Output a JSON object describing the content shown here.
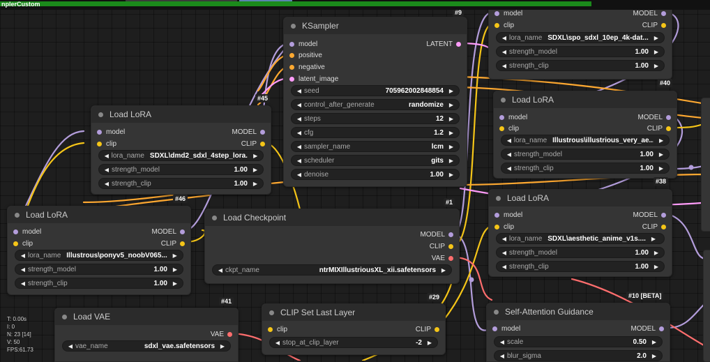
{
  "topbar": {
    "title": "nplerCustom"
  },
  "stats": {
    "t": "T: 0.00s",
    "i": "I: 0",
    "n": "N: 23 [14]",
    "v": "V: 50",
    "fps": "FPS:61.73"
  },
  "badges": {
    "b45": "#45",
    "b40": "#40",
    "b38": "#38",
    "b46": "#46",
    "b1": "#1",
    "b29": "#29",
    "b41": "#41",
    "b10": "#10 [BETA]",
    "b9": "#9"
  },
  "ksampler": {
    "title": "KSampler",
    "inputs": [
      "model",
      "positive",
      "negative",
      "latent_image"
    ],
    "output": "LATENT",
    "widgets": [
      {
        "label": "seed",
        "value": "705962002848854"
      },
      {
        "label": "control_after_generate",
        "value": "randomize"
      },
      {
        "label": "steps",
        "value": "12"
      },
      {
        "label": "cfg",
        "value": "1.2"
      },
      {
        "label": "sampler_name",
        "value": "lcm"
      },
      {
        "label": "scheduler",
        "value": "gits"
      },
      {
        "label": "denoise",
        "value": "1.00"
      }
    ]
  },
  "lora_top_right": {
    "inputs": [
      "model",
      "clip"
    ],
    "outputs": [
      "MODEL",
      "CLIP"
    ],
    "lora_label": "lora_name",
    "lora_value": "SDXL\\spo_sdxl_10ep_4k-dat...",
    "sm_label": "strength_model",
    "sm_value": "1.00",
    "sc_label": "strength_clip",
    "sc_value": "1.00"
  },
  "lora38": {
    "title": "Load LoRA",
    "inputs": [
      "model",
      "clip"
    ],
    "outputs": [
      "MODEL",
      "CLIP"
    ],
    "lora_label": "lora_name",
    "lora_value": "Illustrous\\illustrious_very_ae...",
    "sm_label": "strength_model",
    "sm_value": "1.00",
    "sc_label": "strength_clip",
    "sc_value": "1.00"
  },
  "lora10": {
    "title": "Load LoRA",
    "inputs": [
      "model",
      "clip"
    ],
    "outputs": [
      "MODEL",
      "CLIP"
    ],
    "lora_label": "lora_name",
    "lora_value": "SDXL\\aesthetic_anime_v1s....",
    "sm_label": "strength_model",
    "sm_value": "1.00",
    "sc_label": "strength_clip",
    "sc_value": "1.00"
  },
  "lora46": {
    "title": "Load LoRA",
    "inputs": [
      "model",
      "clip"
    ],
    "outputs": [
      "MODEL",
      "CLIP"
    ],
    "lora_label": "lora_name",
    "lora_value": "SDXL\\dmd2_sdxl_4step_lora...",
    "sm_label": "strength_model",
    "sm_value": "1.00",
    "sc_label": "strength_clip",
    "sc_value": "1.00"
  },
  "lora41": {
    "title": "Load LoRA",
    "inputs": [
      "model",
      "clip"
    ],
    "outputs": [
      "MODEL",
      "CLIP"
    ],
    "lora_label": "lora_name",
    "lora_value": "Illustrous\\ponyv5_noobV065...",
    "sm_label": "strength_model",
    "sm_value": "1.00",
    "sc_label": "strength_clip",
    "sc_value": "1.00"
  },
  "checkpoint": {
    "title": "Load Checkpoint",
    "outputs": [
      "MODEL",
      "CLIP",
      "VAE"
    ],
    "ckpt_label": "ckpt_name",
    "ckpt_value": "ntrMIXIllustriousXL_xii.safetensors"
  },
  "vae": {
    "title": "Load VAE",
    "output": "VAE",
    "label": "vae_name",
    "value": "sdxl_vae.safetensors"
  },
  "clipset": {
    "title": "CLIP Set Last Layer",
    "input": "clip",
    "output": "CLIP",
    "label": "stop_at_clip_layer",
    "value": "-2"
  },
  "sag": {
    "title": "Self-Attention Guidance",
    "input": "model",
    "output": "MODEL",
    "w1_label": "scale",
    "w1_value": "0.50",
    "w2_label": "blur_sigma",
    "w2_value": "2.0"
  },
  "colors": {
    "model": "#b39ddb",
    "clip": "#f5c518",
    "vae": "#ff6e6e",
    "conditioning": "#ffa931",
    "latent": "#ff9cf9",
    "progress": "#1b8a1b"
  }
}
